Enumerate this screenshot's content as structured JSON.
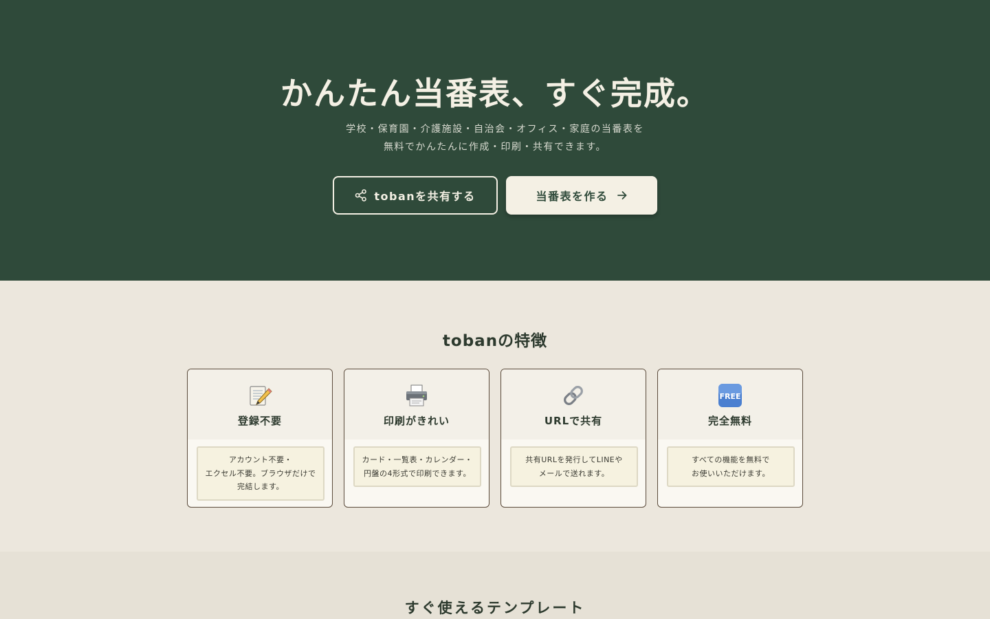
{
  "hero": {
    "title": "かんたん当番表、すぐ完成。",
    "subtitle_line1": "学校・保育園・介護施設・自治会・オフィス・家庭の当番表を",
    "subtitle_line2": "無料でかんたんに作成・印刷・共有できます。",
    "share_button": "tobanを共有する",
    "create_button": "当番表を作る"
  },
  "features": {
    "title": "tobanの特徴",
    "items": [
      {
        "icon": "memo-icon",
        "title": "登録不要",
        "desc": "アカウント不要・\nエクセル不要。ブラウザだけで\n完結します。"
      },
      {
        "icon": "printer-icon",
        "title": "印刷がきれい",
        "desc": "カード・一覧表・カレンダー・\n円盤の4形式で印刷できます。"
      },
      {
        "icon": "link-icon",
        "title": "URLで共有",
        "desc": "共有URLを発行してLINEや\nメールで送れます。"
      },
      {
        "icon": "free-icon",
        "title": "完全無料",
        "desc": "すべての機能を無料で\nお使いいただけます。"
      }
    ]
  },
  "templates": {
    "title": "すぐ使えるテンプレート"
  },
  "colors": {
    "hero_bg": "#2f4a3a",
    "cream": "#f4f0e4",
    "page_bg": "#ece7dd"
  }
}
